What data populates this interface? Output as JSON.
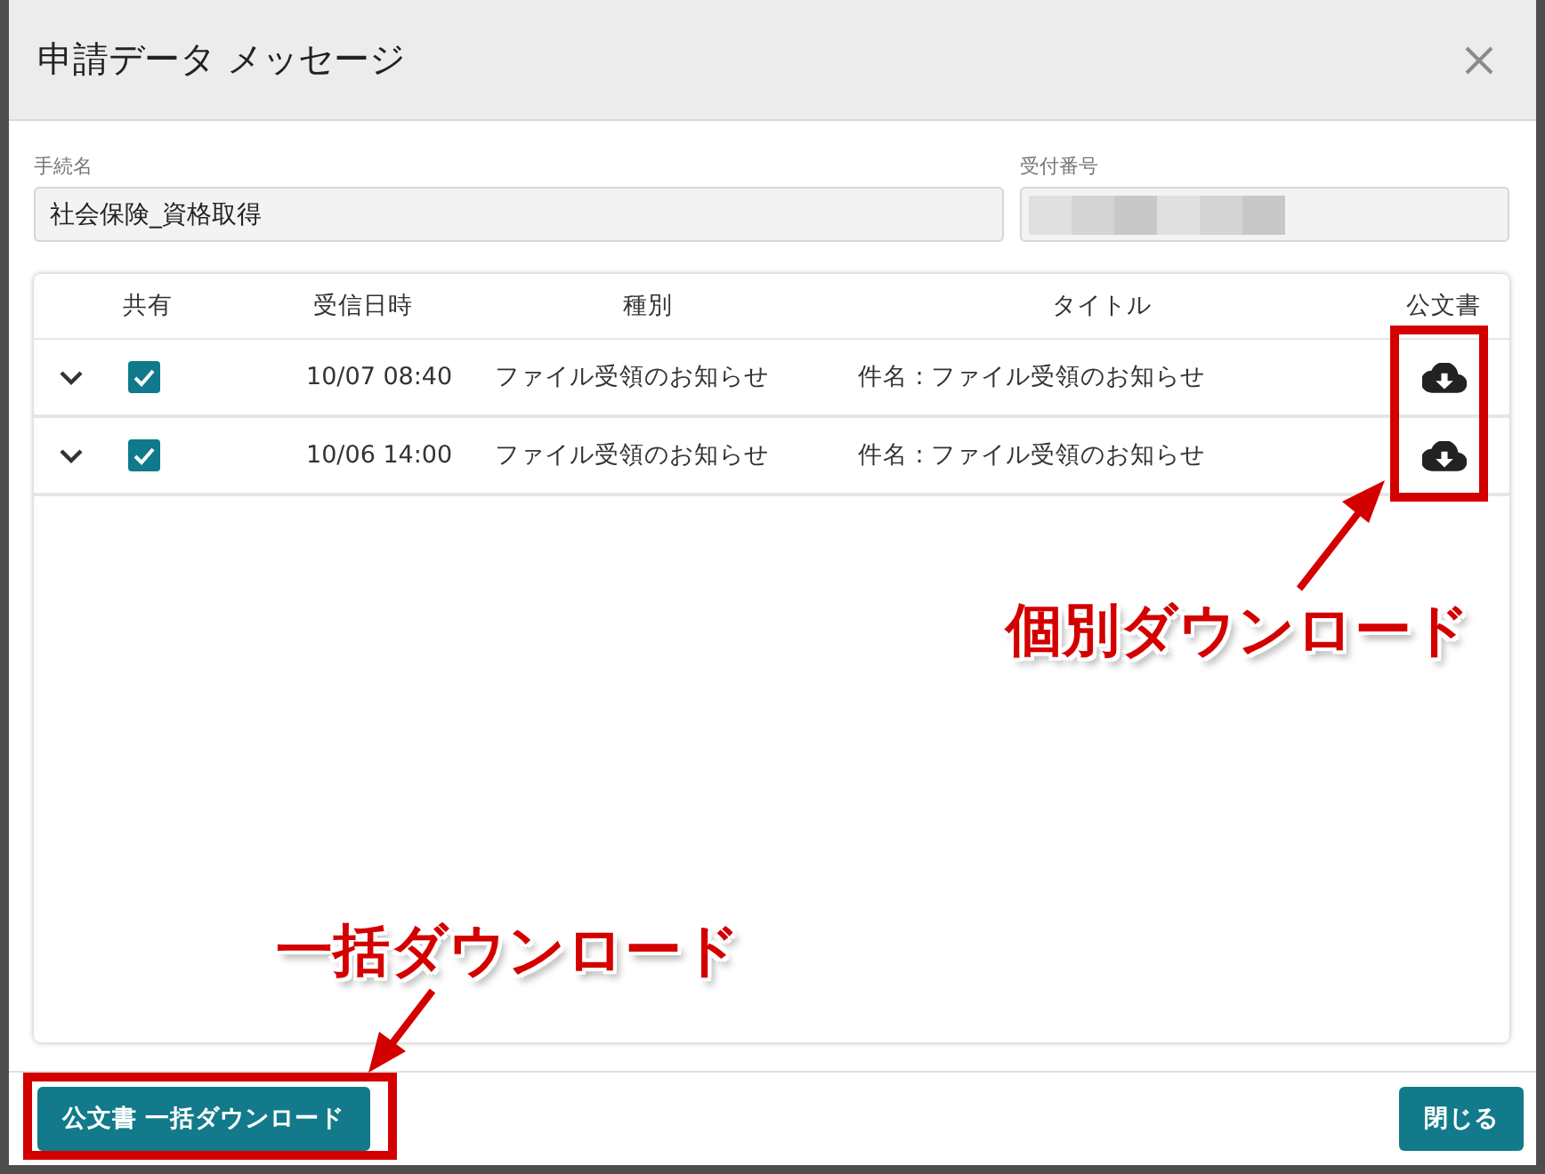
{
  "dialog": {
    "title": "申請データ メッセージ"
  },
  "fields": [
    {
      "label": "手続名",
      "value": "社会保険_資格取得",
      "redacted": false
    },
    {
      "label": "受付番号",
      "redacted": true
    }
  ],
  "table": {
    "columns": [
      "共有",
      "受信日時",
      "種別",
      "タイトル",
      "公文書"
    ],
    "rows": [
      {
        "expanded": false,
        "shared": true,
        "received": "10/07 08:40",
        "type": "ファイル受領のお知らせ",
        "title": "件名 : ファイル受領のお知らせ"
      },
      {
        "expanded": false,
        "shared": true,
        "received": "10/06 14:00",
        "type": "ファイル受領のお知らせ",
        "title": "件名 : ファイル受領のお知らせ"
      }
    ]
  },
  "footer": {
    "bulk_button": "公文書 一括ダウンロード",
    "close_button": "閉じる"
  },
  "annotations": [
    {
      "kind": "callout",
      "text": "個別ダウンロード"
    },
    {
      "kind": "callout",
      "text": "一括ダウンロード"
    }
  ]
}
